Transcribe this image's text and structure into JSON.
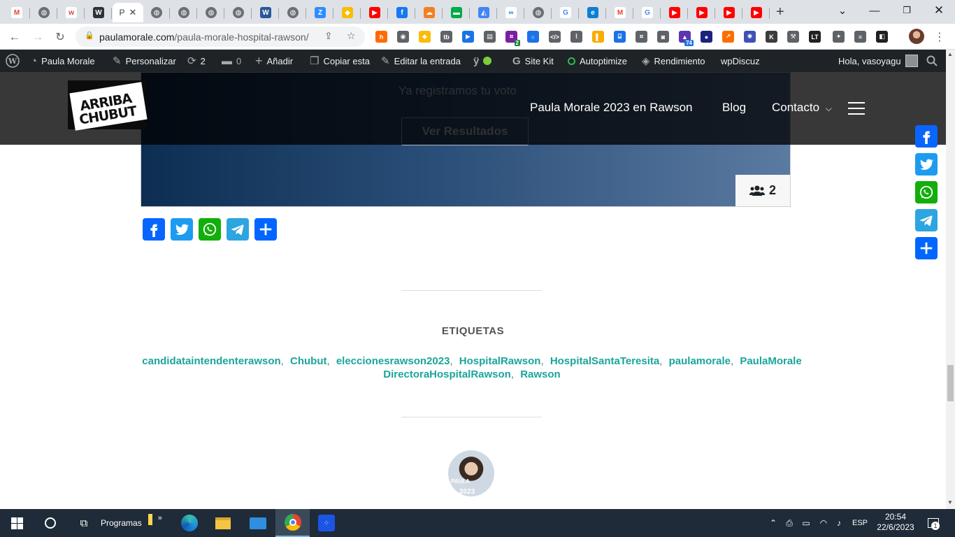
{
  "browser": {
    "active_tab_title": "P",
    "tab_icons": [
      "gmail-icon",
      "globe-icon",
      "wordtune-icon",
      "wordpress-icon",
      "globe-icon",
      "globe-icon",
      "globe-icon",
      "globe-icon",
      "word-icon",
      "globe-icon",
      "zcal-icon",
      "keep-icon",
      "youtube-icon",
      "facebook-icon",
      "cloudflare-icon",
      "chat-icon",
      "drive-icon",
      "meta-icon",
      "globe-icon",
      "google-plus-icon",
      "edge-icon",
      "gmail-icon",
      "google-icon",
      "youtube-icon",
      "youtube-icon",
      "youtube-icon",
      "youtube-icon"
    ],
    "new_tab_label": "+",
    "url_host": "paulamorale.com",
    "url_path": "/paula-morale-hospital-rawson/",
    "extension_badges": {
      "tag_ext": "2",
      "grad_ext": "74"
    }
  },
  "adminbar": {
    "site_name": "Paula Morale",
    "customize": "Personalizar",
    "updates_count": "2",
    "comments_count": "0",
    "add_new": "Añadir",
    "copy": "Copiar esta",
    "edit": "Editar la entrada",
    "site_kit": "Site Kit",
    "autoptimize": "Autoptimize",
    "performance": "Rendimiento",
    "wpdiscuz": "wpDiscuz",
    "greeting": "Hola, vasoyagu"
  },
  "header": {
    "logo_line1": "ARRIBA",
    "logo_line2": "CHUBUT",
    "nav": [
      "Paula Morale 2023 en Rawson",
      "Blog",
      "Contacto"
    ]
  },
  "poll": {
    "voted_text": "Ya registramos tu voto",
    "results_button": "Ver Resultados",
    "voters_count": "2"
  },
  "share": {
    "inline": [
      "Facebook",
      "Twitter",
      "WhatsApp",
      "Telegram",
      "Compartir"
    ],
    "floating": [
      "Facebook",
      "Twitter",
      "WhatsApp",
      "Telegram",
      "Compartir"
    ],
    "colors": {
      "facebook": "#0866FF",
      "twitter": "#1D9BF0",
      "whatsapp": "#12AF0A",
      "telegram": "#2CA5E0",
      "share": "#0166FF"
    }
  },
  "tags": {
    "heading": "ETIQUETAS",
    "items": [
      "candidataintendenterawson",
      "Chubut",
      "eleccionesrawson2023",
      "HospitalRawson",
      "HospitalSantaTeresita",
      "paulamorale",
      "PaulaMorale DirectoraHospitalRawson",
      "Rawson"
    ]
  },
  "author": {
    "avatar_text": "PAULA",
    "avatar_number": "2023"
  },
  "taskbar": {
    "programs_label": "Programas",
    "language": "ESP",
    "time": "20:54",
    "date": "22/6/2023",
    "notifications": "1"
  }
}
